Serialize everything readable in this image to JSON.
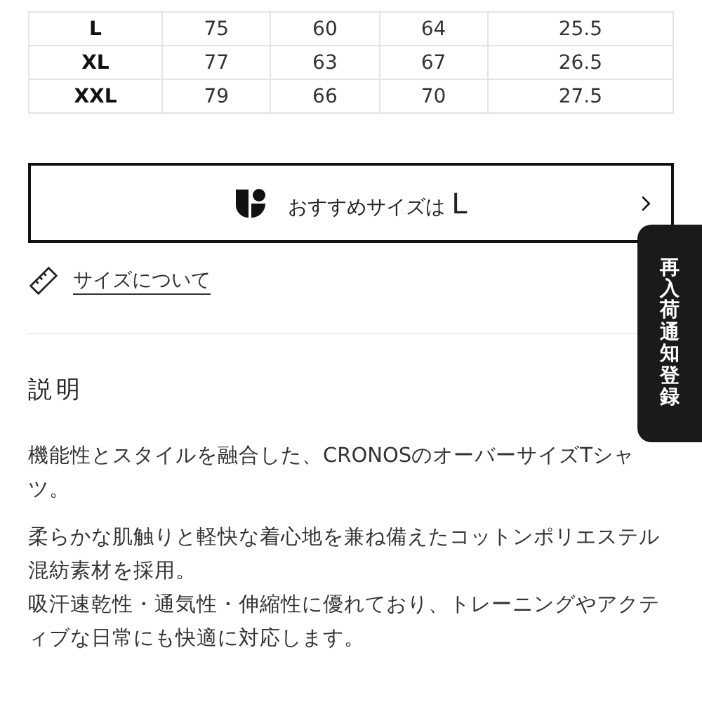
{
  "size_table": {
    "rows": [
      {
        "size": "L",
        "values": [
          "75",
          "60",
          "64",
          "25.5"
        ]
      },
      {
        "size": "XL",
        "values": [
          "77",
          "63",
          "67",
          "26.5"
        ]
      },
      {
        "size": "XXL",
        "values": [
          "79",
          "66",
          "70",
          "27.5"
        ]
      }
    ]
  },
  "recommend_button": {
    "label": "おすすめサイズは",
    "size": "L"
  },
  "size_link": "サイズについて",
  "restock_tab": "再入荷通知登録",
  "description": {
    "heading": "説明",
    "paragraphs": [
      [
        "機能性とスタイルを融合した、CRONOSのオーバーサイズTシャツ。"
      ],
      [
        "柔らかな肌触りと軽快な着心地を兼ね備えたコットンポリエステル混紡素材を採用。",
        "吸汗速乾性・通気性・伸縮性に優れており、トレーニングやアクティブな日常にも快適に対応します。"
      ]
    ]
  }
}
